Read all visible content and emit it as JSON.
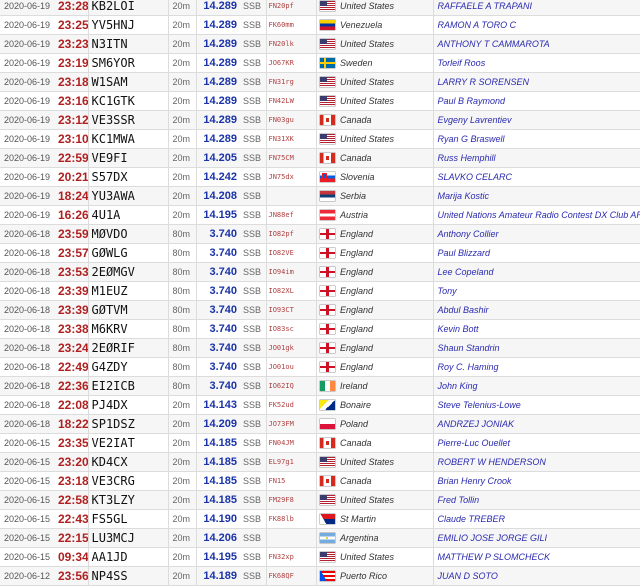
{
  "spots": [
    {
      "date": "2020-06-19",
      "time": "23:28",
      "call": "KB2LOI",
      "band": "20m",
      "freq": "14.289",
      "mode": "SSB",
      "grid": "FN20pf",
      "flag": "us",
      "country": "United States",
      "name": "RAFFAELE A TRAPANI"
    },
    {
      "date": "2020-06-19",
      "time": "23:25",
      "call": "YV5HNJ",
      "band": "20m",
      "freq": "14.289",
      "mode": "SSB",
      "grid": "FK60mm",
      "flag": "ve",
      "country": "Venezuela",
      "name": "RAMON A TORO C"
    },
    {
      "date": "2020-06-19",
      "time": "23:23",
      "call": "N3ITN",
      "band": "20m",
      "freq": "14.289",
      "mode": "SSB",
      "grid": "FN20lk",
      "flag": "us",
      "country": "United States",
      "name": "ANTHONY T CAMMAROTA"
    },
    {
      "date": "2020-06-19",
      "time": "23:19",
      "call": "SM6YOR",
      "band": "20m",
      "freq": "14.289",
      "mode": "SSB",
      "grid": "JO67KR",
      "flag": "se",
      "country": "Sweden",
      "name": "Torleif Roos"
    },
    {
      "date": "2020-06-19",
      "time": "23:18",
      "call": "W1SAM",
      "band": "20m",
      "freq": "14.289",
      "mode": "SSB",
      "grid": "FN31rg",
      "flag": "us",
      "country": "United States",
      "name": "LARRY R SORENSEN"
    },
    {
      "date": "2020-06-19",
      "time": "23:16",
      "call": "KC1GTK",
      "band": "20m",
      "freq": "14.289",
      "mode": "SSB",
      "grid": "FN42LW",
      "flag": "us",
      "country": "United States",
      "name": "Paul B Raymond"
    },
    {
      "date": "2020-06-19",
      "time": "23:12",
      "call": "VE3SSR",
      "band": "20m",
      "freq": "14.289",
      "mode": "SSB",
      "grid": "FN03gu",
      "flag": "ca",
      "country": "Canada",
      "name": "Evgeny Lavrentiev"
    },
    {
      "date": "2020-06-19",
      "time": "23:10",
      "call": "KC1MWA",
      "band": "20m",
      "freq": "14.289",
      "mode": "SSB",
      "grid": "FN31XK",
      "flag": "us",
      "country": "United States",
      "name": "Ryan G Braswell"
    },
    {
      "date": "2020-06-19",
      "time": "22:59",
      "call": "VE9FI",
      "band": "20m",
      "freq": "14.205",
      "mode": "SSB",
      "grid": "FN75CM",
      "flag": "ca",
      "country": "Canada",
      "name": "Russ Hemphill"
    },
    {
      "date": "2020-06-19",
      "time": "20:21",
      "call": "S57DX",
      "band": "20m",
      "freq": "14.242",
      "mode": "SSB",
      "grid": "JN75dx",
      "flag": "si",
      "country": "Slovenia",
      "name": "SLAVKO CELARC"
    },
    {
      "date": "2020-06-19",
      "time": "18:24",
      "call": "YU3AWA",
      "band": "20m",
      "freq": "14.208",
      "mode": "SSB",
      "grid": "",
      "flag": "rs",
      "country": "Serbia",
      "name": "Marija Kostic"
    },
    {
      "date": "2020-06-19",
      "time": "16:26",
      "call": "4U1A",
      "band": "20m",
      "freq": "14.195",
      "mode": "SSB",
      "grid": "JN88ef",
      "flag": "at",
      "country": "Austria",
      "name": "United Nations Amateur Radio Contest DX Club ARCDXC"
    },
    {
      "date": "2020-06-18",
      "time": "23:59",
      "call": "MØVDO",
      "band": "80m",
      "freq": "3.740",
      "mode": "SSB",
      "grid": "IO82pf",
      "flag": "en",
      "country": "England",
      "name": "Anthony Collier"
    },
    {
      "date": "2020-06-18",
      "time": "23:57",
      "call": "GØWLG",
      "band": "80m",
      "freq": "3.740",
      "mode": "SSB",
      "grid": "IO82VE",
      "flag": "en",
      "country": "England",
      "name": "Paul Blizzard"
    },
    {
      "date": "2020-06-18",
      "time": "23:53",
      "call": "2EØMGV",
      "band": "80m",
      "freq": "3.740",
      "mode": "SSB",
      "grid": "IO94im",
      "flag": "en",
      "country": "England",
      "name": "Lee Copeland"
    },
    {
      "date": "2020-06-18",
      "time": "23:39",
      "call": "M1EUZ",
      "band": "80m",
      "freq": "3.740",
      "mode": "SSB",
      "grid": "IO82XL",
      "flag": "en",
      "country": "England",
      "name": "Tony"
    },
    {
      "date": "2020-06-18",
      "time": "23:39",
      "call": "GØTVM",
      "band": "80m",
      "freq": "3.740",
      "mode": "SSB",
      "grid": "IO93CT",
      "flag": "en",
      "country": "England",
      "name": "Abdul Bashir"
    },
    {
      "date": "2020-06-18",
      "time": "23:38",
      "call": "M6KRV",
      "band": "80m",
      "freq": "3.740",
      "mode": "SSB",
      "grid": "IO83sc",
      "flag": "en",
      "country": "England",
      "name": "Kevin Bott"
    },
    {
      "date": "2020-06-18",
      "time": "23:24",
      "call": "2EØRIF",
      "band": "80m",
      "freq": "3.740",
      "mode": "SSB",
      "grid": "JO01gk",
      "flag": "en",
      "country": "England",
      "name": "Shaun Standrin"
    },
    {
      "date": "2020-06-18",
      "time": "22:49",
      "call": "G4ZDY",
      "band": "80m",
      "freq": "3.740",
      "mode": "SSB",
      "grid": "JO01ou",
      "flag": "en",
      "country": "England",
      "name": "Roy C. Haming"
    },
    {
      "date": "2020-06-18",
      "time": "22:36",
      "call": "EI2ICB",
      "band": "80m",
      "freq": "3.740",
      "mode": "SSB",
      "grid": "IO62IQ",
      "flag": "ie",
      "country": "Ireland",
      "name": "John King"
    },
    {
      "date": "2020-06-18",
      "time": "22:08",
      "call": "PJ4DX",
      "band": "20m",
      "freq": "14.143",
      "mode": "SSB",
      "grid": "FK52ud",
      "flag": "bq",
      "country": "Bonaire",
      "name": "Steve Telenius-Lowe"
    },
    {
      "date": "2020-06-18",
      "time": "18:22",
      "call": "SP1DSZ",
      "band": "20m",
      "freq": "14.209",
      "mode": "SSB",
      "grid": "JO73FM",
      "flag": "pl",
      "country": "Poland",
      "name": "ANDRZEJ JONIAK"
    },
    {
      "date": "2020-06-15",
      "time": "23:35",
      "call": "VE2IAT",
      "band": "20m",
      "freq": "14.185",
      "mode": "SSB",
      "grid": "FN04JM",
      "flag": "ca",
      "country": "Canada",
      "name": "Pierre-Luc Ouellet"
    },
    {
      "date": "2020-06-15",
      "time": "23:20",
      "call": "KD4CX",
      "band": "20m",
      "freq": "14.185",
      "mode": "SSB",
      "grid": "EL97g1",
      "flag": "us",
      "country": "United States",
      "name": "ROBERT W HENDERSON"
    },
    {
      "date": "2020-06-15",
      "time": "23:18",
      "call": "VE3CRG",
      "band": "20m",
      "freq": "14.185",
      "mode": "SSB",
      "grid": "FN15",
      "flag": "ca",
      "country": "Canada",
      "name": "Brian Henry Crook"
    },
    {
      "date": "2020-06-15",
      "time": "22:58",
      "call": "KT3LZY",
      "band": "20m",
      "freq": "14.185",
      "mode": "SSB",
      "grid": "FM29F8",
      "flag": "us",
      "country": "United States",
      "name": "Fred Tollin"
    },
    {
      "date": "2020-06-15",
      "time": "22:43",
      "call": "FS5GL",
      "band": "20m",
      "freq": "14.190",
      "mode": "SSB",
      "grid": "FK88lb",
      "flag": "sx",
      "country": "St Martin",
      "name": "Claude TREBER"
    },
    {
      "date": "2020-06-15",
      "time": "22:15",
      "call": "LU3MCJ",
      "band": "20m",
      "freq": "14.206",
      "mode": "SSB",
      "grid": "",
      "flag": "ar",
      "country": "Argentina",
      "name": "EMILIO JOSE JORGE GILI"
    },
    {
      "date": "2020-06-15",
      "time": "09:34",
      "call": "AA1JD",
      "band": "20m",
      "freq": "14.195",
      "mode": "SSB",
      "grid": "FN32xp",
      "flag": "us",
      "country": "United States",
      "name": "MATTHEW P SLOMCHECK"
    },
    {
      "date": "2020-06-12",
      "time": "23:56",
      "call": "NP4SS",
      "band": "20m",
      "freq": "14.189",
      "mode": "SSB",
      "grid": "FK68QF",
      "flag": "pr",
      "country": "Puerto Rico",
      "name": "JUAN D SOTO"
    }
  ]
}
